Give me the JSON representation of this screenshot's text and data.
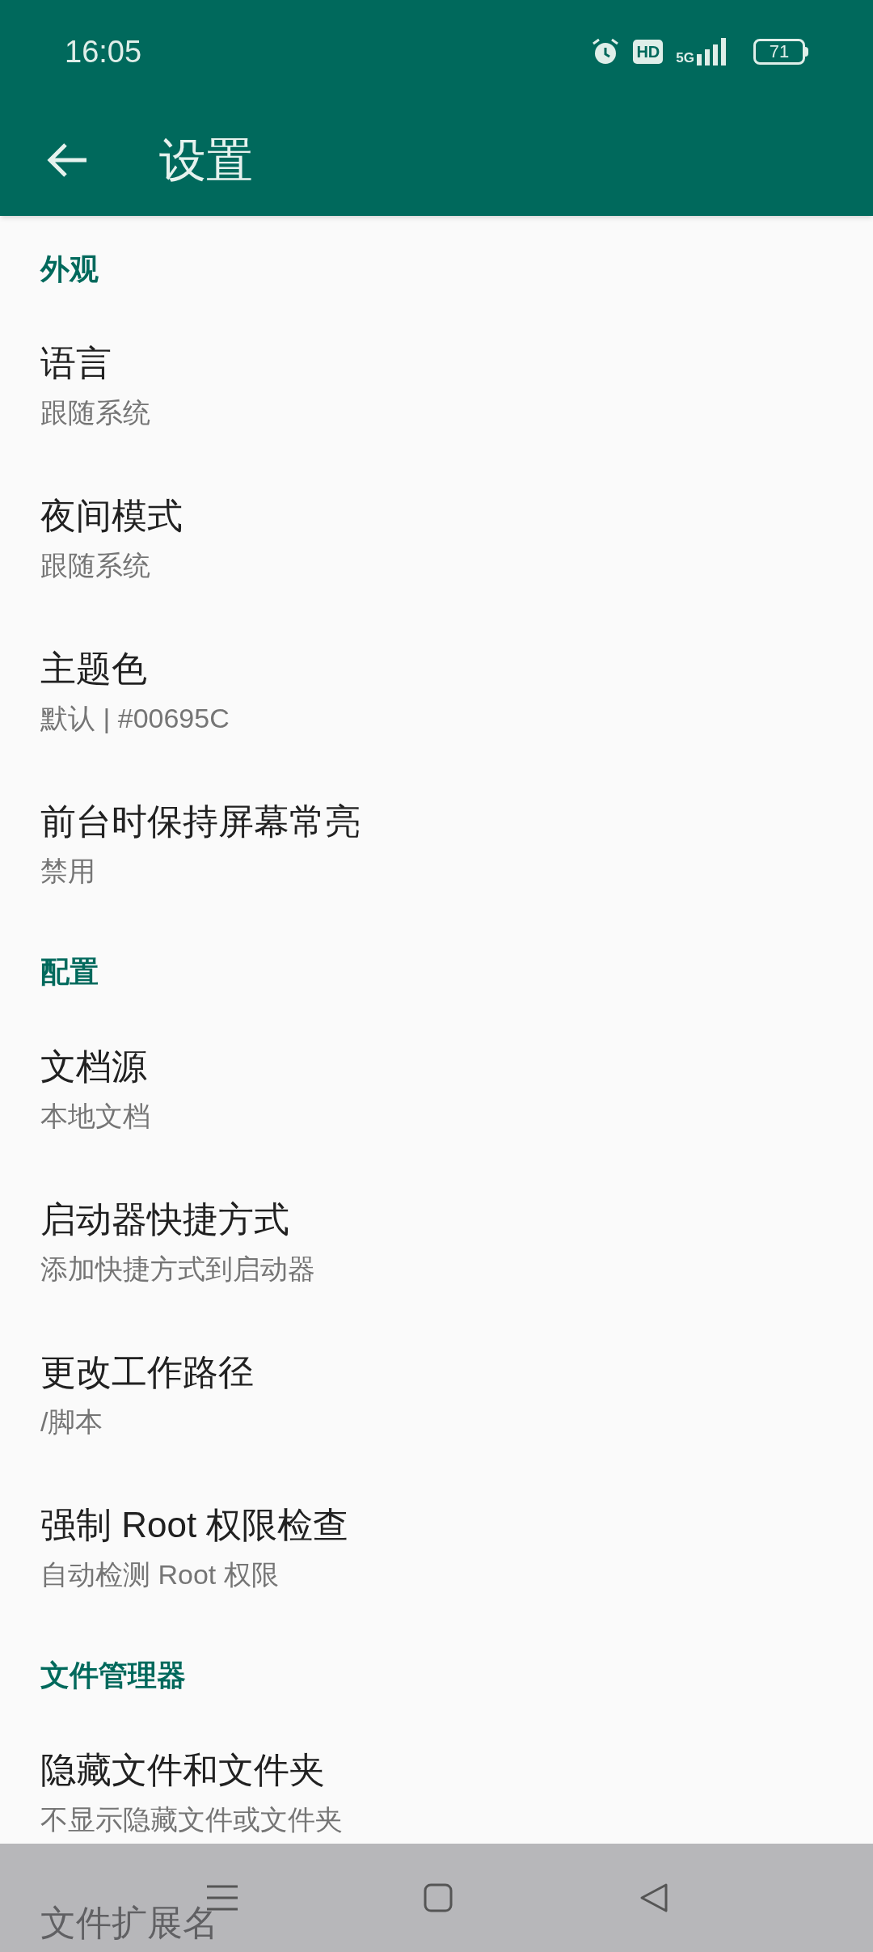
{
  "status_bar": {
    "time": "16:05",
    "hd": "HD",
    "network": "5G",
    "battery": "71"
  },
  "toolbar": {
    "title": "设置"
  },
  "sections": [
    {
      "header": "外观",
      "items": [
        {
          "title": "语言",
          "summary": "跟随系统"
        },
        {
          "title": "夜间模式",
          "summary": "跟随系统"
        },
        {
          "title": "主题色",
          "summary": "默认 | #00695C"
        },
        {
          "title": "前台时保持屏幕常亮",
          "summary": "禁用"
        }
      ]
    },
    {
      "header": "配置",
      "items": [
        {
          "title": "文档源",
          "summary": "本地文档"
        },
        {
          "title": "启动器快捷方式",
          "summary": "添加快捷方式到启动器"
        },
        {
          "title": "更改工作路径",
          "summary": "/脚本"
        },
        {
          "title": "强制 Root 权限检查",
          "summary": "自动检测 Root 权限"
        }
      ]
    },
    {
      "header": "文件管理器",
      "items": [
        {
          "title": "隐藏文件和文件夹",
          "summary": "不显示隐藏文件或文件夹"
        },
        {
          "title": "文件扩展名"
        }
      ]
    }
  ]
}
